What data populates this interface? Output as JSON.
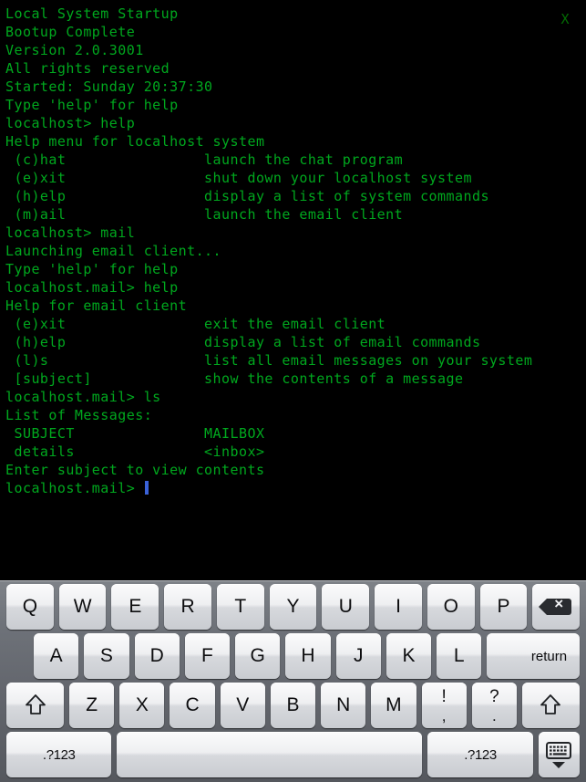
{
  "terminal": {
    "close_label": "X",
    "cursor": "block-cursor",
    "lines": [
      "Local System Startup",
      "Bootup Complete",
      "Version 2.0.3001",
      "All rights reserved",
      "Started: Sunday 20:37:30",
      "Type 'help' for help",
      "localhost> help",
      "Help menu for localhost system",
      " (c)hat                launch the chat program",
      " (e)xit                shut down your localhost system",
      " (h)elp                display a list of system commands",
      " (m)ail                launch the email client",
      "localhost> mail",
      "Launching email client...",
      "Type 'help' for help",
      "localhost.mail> help",
      "Help for email client",
      " (e)xit                exit the email client",
      " (h)elp                display a list of email commands",
      " (l)s                  list all email messages on your system",
      " [subject]             show the contents of a message",
      "localhost.mail> ls",
      "List of Messages:",
      " SUBJECT               MAILBOX",
      " details               <inbox>",
      "Enter subject to view contents"
    ],
    "prompt": "localhost.mail> ",
    "text_color": "#00a81e",
    "cursor_color": "#3a62d8",
    "background_color": "#000000"
  },
  "keyboard": {
    "row1": [
      {
        "label": "Q",
        "name": "key-q",
        "type": "letter"
      },
      {
        "label": "W",
        "name": "key-w",
        "type": "letter"
      },
      {
        "label": "E",
        "name": "key-e",
        "type": "letter"
      },
      {
        "label": "R",
        "name": "key-r",
        "type": "letter"
      },
      {
        "label": "T",
        "name": "key-t",
        "type": "letter"
      },
      {
        "label": "Y",
        "name": "key-y",
        "type": "letter"
      },
      {
        "label": "U",
        "name": "key-u",
        "type": "letter"
      },
      {
        "label": "I",
        "name": "key-i",
        "type": "letter"
      },
      {
        "label": "O",
        "name": "key-o",
        "type": "letter"
      },
      {
        "label": "P",
        "name": "key-p",
        "type": "letter"
      }
    ],
    "backspace": {
      "label": "",
      "name": "backspace-key",
      "icon": "backspace-icon"
    },
    "row2": [
      {
        "label": "A",
        "name": "key-a",
        "type": "letter"
      },
      {
        "label": "S",
        "name": "key-s",
        "type": "letter"
      },
      {
        "label": "D",
        "name": "key-d",
        "type": "letter"
      },
      {
        "label": "F",
        "name": "key-f",
        "type": "letter"
      },
      {
        "label": "G",
        "name": "key-g",
        "type": "letter"
      },
      {
        "label": "H",
        "name": "key-h",
        "type": "letter"
      },
      {
        "label": "J",
        "name": "key-j",
        "type": "letter"
      },
      {
        "label": "K",
        "name": "key-k",
        "type": "letter"
      },
      {
        "label": "L",
        "name": "key-l",
        "type": "letter"
      }
    ],
    "return": {
      "label": "return",
      "name": "return-key"
    },
    "row3": [
      {
        "label": "Z",
        "name": "key-z",
        "type": "letter"
      },
      {
        "label": "X",
        "name": "key-x",
        "type": "letter"
      },
      {
        "label": "C",
        "name": "key-c",
        "type": "letter"
      },
      {
        "label": "V",
        "name": "key-v",
        "type": "letter"
      },
      {
        "label": "B",
        "name": "key-b",
        "type": "letter"
      },
      {
        "label": "N",
        "name": "key-n",
        "type": "letter"
      },
      {
        "label": "M",
        "name": "key-m",
        "type": "letter"
      }
    ],
    "punct1": {
      "top": "!",
      "bottom": ",",
      "name": "key-exclam-comma"
    },
    "punct2": {
      "top": "?",
      "bottom": ".",
      "name": "key-question-period"
    },
    "shift_left": {
      "label": "",
      "name": "shift-key-left",
      "icon": "shift-arrow-icon"
    },
    "shift_right": {
      "label": "",
      "name": "shift-key-right",
      "icon": "shift-arrow-icon"
    },
    "numeric_left": {
      "label": ".?123",
      "name": "numeric-switch-left"
    },
    "numeric_right": {
      "label": ".?123",
      "name": "numeric-switch-right"
    },
    "spacebar": {
      "label": "",
      "name": "spacebar"
    },
    "hide_keyboard": {
      "label": "",
      "name": "hide-keyboard-key",
      "icon": "keyboard-dismiss-icon"
    }
  }
}
